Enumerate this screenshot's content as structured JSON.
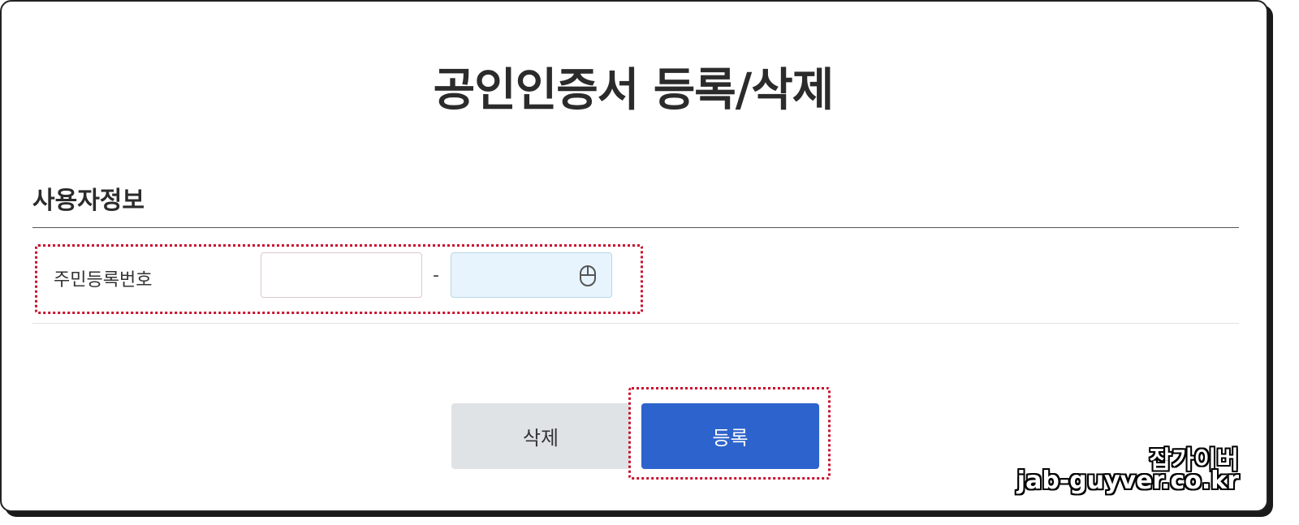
{
  "page": {
    "title": "공인인증서 등록/삭제"
  },
  "section": {
    "title": "사용자정보"
  },
  "form": {
    "rrn_label": "주민등록번호",
    "rrn_front_value": "",
    "rrn_separator": "-",
    "rrn_back_value": "",
    "rrn_back_icon": "mouse-icon"
  },
  "buttons": {
    "delete_label": "삭제",
    "register_label": "등록"
  },
  "watermark": {
    "line1": "잡가이버",
    "line2": "jab-guyver.co.kr"
  },
  "colors": {
    "register_button": "#2d63cc",
    "delete_button": "#dfe3e6",
    "secure_input_bg": "#e8f4fd",
    "highlight_dotted": "#c8102e"
  }
}
